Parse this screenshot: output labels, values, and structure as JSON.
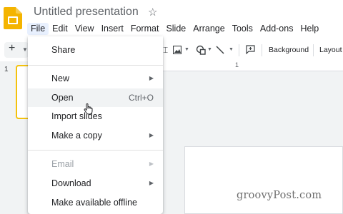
{
  "header": {
    "title": "Untitled presentation",
    "star_icon": "star-outline-icon",
    "app_icon": "google-slides-logo",
    "brand_color": "#f4b400"
  },
  "menubar": {
    "items": [
      "File",
      "Edit",
      "View",
      "Insert",
      "Format",
      "Slide",
      "Arrange",
      "Tools",
      "Add-ons",
      "Help"
    ],
    "active": "File"
  },
  "toolbar": {
    "background_label": "Background",
    "layout_label": "Layout"
  },
  "filmstrip": {
    "slide_number": "1"
  },
  "ruler": {
    "mark": "1"
  },
  "file_menu": {
    "share": "Share",
    "new": "New",
    "open": "Open",
    "open_shortcut": "Ctrl+O",
    "import_slides": "Import slides",
    "make_copy": "Make a copy",
    "email": "Email",
    "download": "Download",
    "make_offline": "Make available offline",
    "hovered": "Open"
  },
  "watermark": "groovyPost.com"
}
